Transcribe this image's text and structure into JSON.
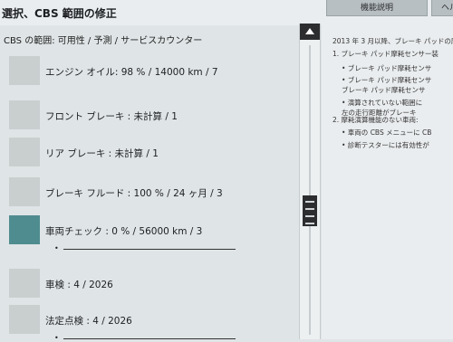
{
  "header": {
    "title": "選択、CBS 範囲の修正",
    "btn_manual": "機能説明",
    "btn_partial": "ヘル"
  },
  "cbs_range_label": "CBS の範囲: 可用性 / 予測 / サービスカウンター",
  "items": [
    {
      "label": "エンジン オイル: 98 % / 14000 km / 7"
    },
    {
      "label": "フロント ブレーキ : 未計算 / 1"
    },
    {
      "label": "リア ブレーキ : 未計算 / 1"
    },
    {
      "label": "ブレーキ フルード : 100 % / 24 ヶ月 / 3"
    },
    {
      "label": "車両チェック : 0 % / 56000 km / 3",
      "bullet": "•"
    },
    {
      "label": "車検 : 4 / 2026"
    },
    {
      "label": "法定点検 : 4 / 2026",
      "bullet": "•"
    }
  ],
  "info_text": {
    "l1": "2013 年 3 月以降、ブレーキ パッドの摩",
    "l2": "1.   ブレーキ パッド摩耗センサー装",
    "l3": "•   ブレーキ パッド摩耗センサ",
    "l4": "•   ブレーキ パッド摩耗センサ",
    "l5": "     ブレーキ パッド摩耗センサ",
    "l6": "•   演算されていない範囲に",
    "l7": "     左の走行距離がブレーキ",
    "l8": "2.   摩耗演算機能のない車両:",
    "l9": "•   車両の CBS メニューに CB",
    "l10": "•   診断テスターには有効性が"
  }
}
